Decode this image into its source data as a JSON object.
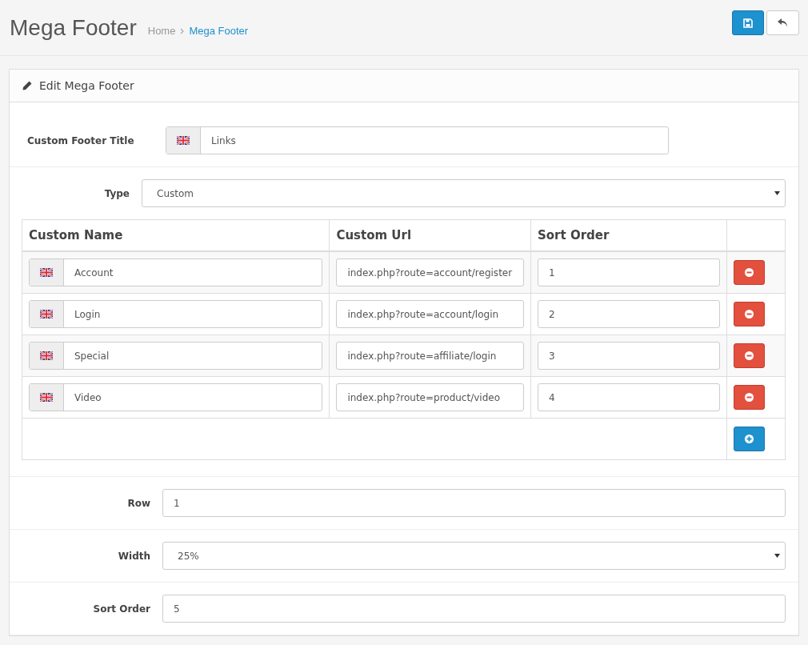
{
  "page": {
    "title": "Mega Footer",
    "breadcrumb": [
      {
        "label": "Home",
        "selected": false
      },
      {
        "label": "Mega Footer",
        "selected": true
      }
    ]
  },
  "panel": {
    "heading": "Edit Mega Footer"
  },
  "title_field": {
    "label": "Custom Footer Title",
    "value": "Links"
  },
  "type_field": {
    "label": "Type",
    "value": "Custom"
  },
  "table": {
    "columns": [
      "Custom Name",
      "Custom Url",
      "Sort Order"
    ],
    "rows": [
      {
        "name": "Account",
        "url": "index.php?route=account/register",
        "sort": "1"
      },
      {
        "name": "Login",
        "url": "index.php?route=account/login",
        "sort": "2"
      },
      {
        "name": "Special",
        "url": "index.php?route=affiliate/login",
        "sort": "3"
      },
      {
        "name": "Video",
        "url": "index.php?route=product/video",
        "sort": "4"
      }
    ]
  },
  "fields": [
    {
      "kind": "input",
      "label": "Row",
      "value": "1"
    },
    {
      "kind": "select",
      "label": "Width",
      "value": "25%"
    },
    {
      "kind": "input",
      "label": "Sort Order",
      "value": "5"
    }
  ]
}
